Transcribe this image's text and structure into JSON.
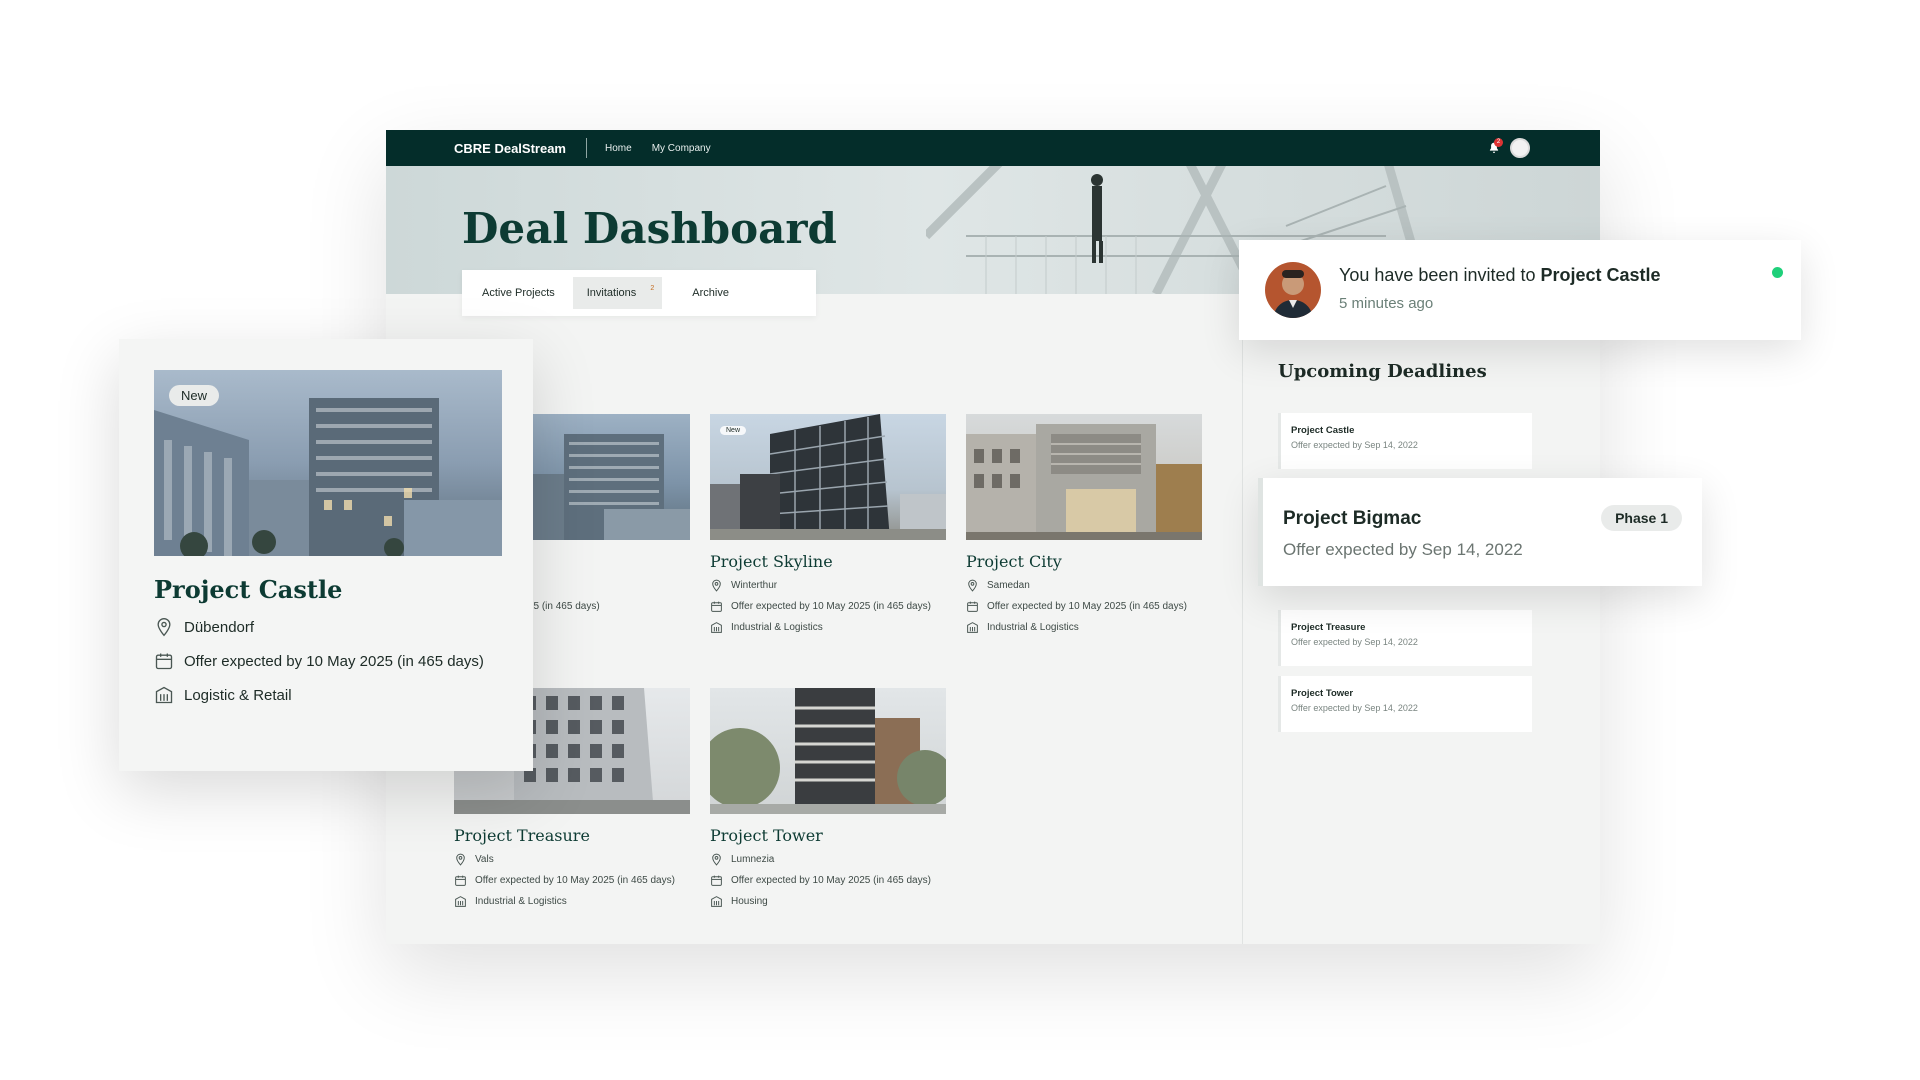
{
  "topbar": {
    "brand": "CBRE DealStream",
    "nav": [
      "Home",
      "My Company"
    ],
    "notification_count": "2"
  },
  "header": {
    "title": "Deal Dashboard"
  },
  "tabs": [
    {
      "label": "Active Projects"
    },
    {
      "label": "Invitations",
      "count": "2"
    },
    {
      "label": "Archive"
    }
  ],
  "projects": [
    {
      "title": "Project Castle",
      "location": "Dübendorf",
      "offer": "Offer expected by 10 May 2025 (in 465 days)",
      "category": "Logistic & Retail",
      "badge": "New",
      "title_visible": "stle",
      "offer_visible": "ed by 10 May 2025 (in 465 days)",
      "category_visible": "tail"
    },
    {
      "title": "Project Skyline",
      "location": "Winterthur",
      "offer": "Offer expected by 10 May 2025 (in 465 days)",
      "category": "Industrial & Logistics",
      "badge": "New"
    },
    {
      "title": "Project City",
      "location": "Samedan",
      "offer": "Offer expected by 10 May 2025 (in 465 days)",
      "category": "Industrial & Logistics"
    },
    {
      "title": "Project Treasure",
      "location": "Vals",
      "offer": "Offer expected by 10 May 2025 (in 465 days)",
      "category": "Industrial & Logistics"
    },
    {
      "title": "Project Tower",
      "location": "Lumnezia",
      "offer": "Offer expected by 10 May 2025 (in 465 days)",
      "category": "Housing"
    }
  ],
  "deadlines": {
    "title": "Upcoming Deadlines",
    "items": [
      {
        "name": "Project Castle",
        "sub": "Offer expected by Sep 14, 2022"
      },
      {
        "name": "Project Treasure",
        "sub": "Offer expected by Sep 14, 2022"
      },
      {
        "name": "Project Tower",
        "sub": "Offer expected by Sep 14, 2022"
      }
    ],
    "expanded": {
      "name": "Project Bigmac",
      "sub": "Offer expected by Sep 14, 2022",
      "phase": "Phase 1"
    }
  },
  "featured": {
    "badge": "New",
    "title": "Project Castle",
    "location": "Dübendorf",
    "offer": "Offer expected by 10 May 2025 (in 465 days)",
    "category": "Logistic & Retail"
  },
  "notification": {
    "prefix": "You have been invited to ",
    "project": "Project Castle",
    "time": "5 minutes ago",
    "status_color": "#1fd07a"
  },
  "colors": {
    "topbar": "#042d2a",
    "title": "#0d3b33",
    "accent_badge": "#d33"
  }
}
